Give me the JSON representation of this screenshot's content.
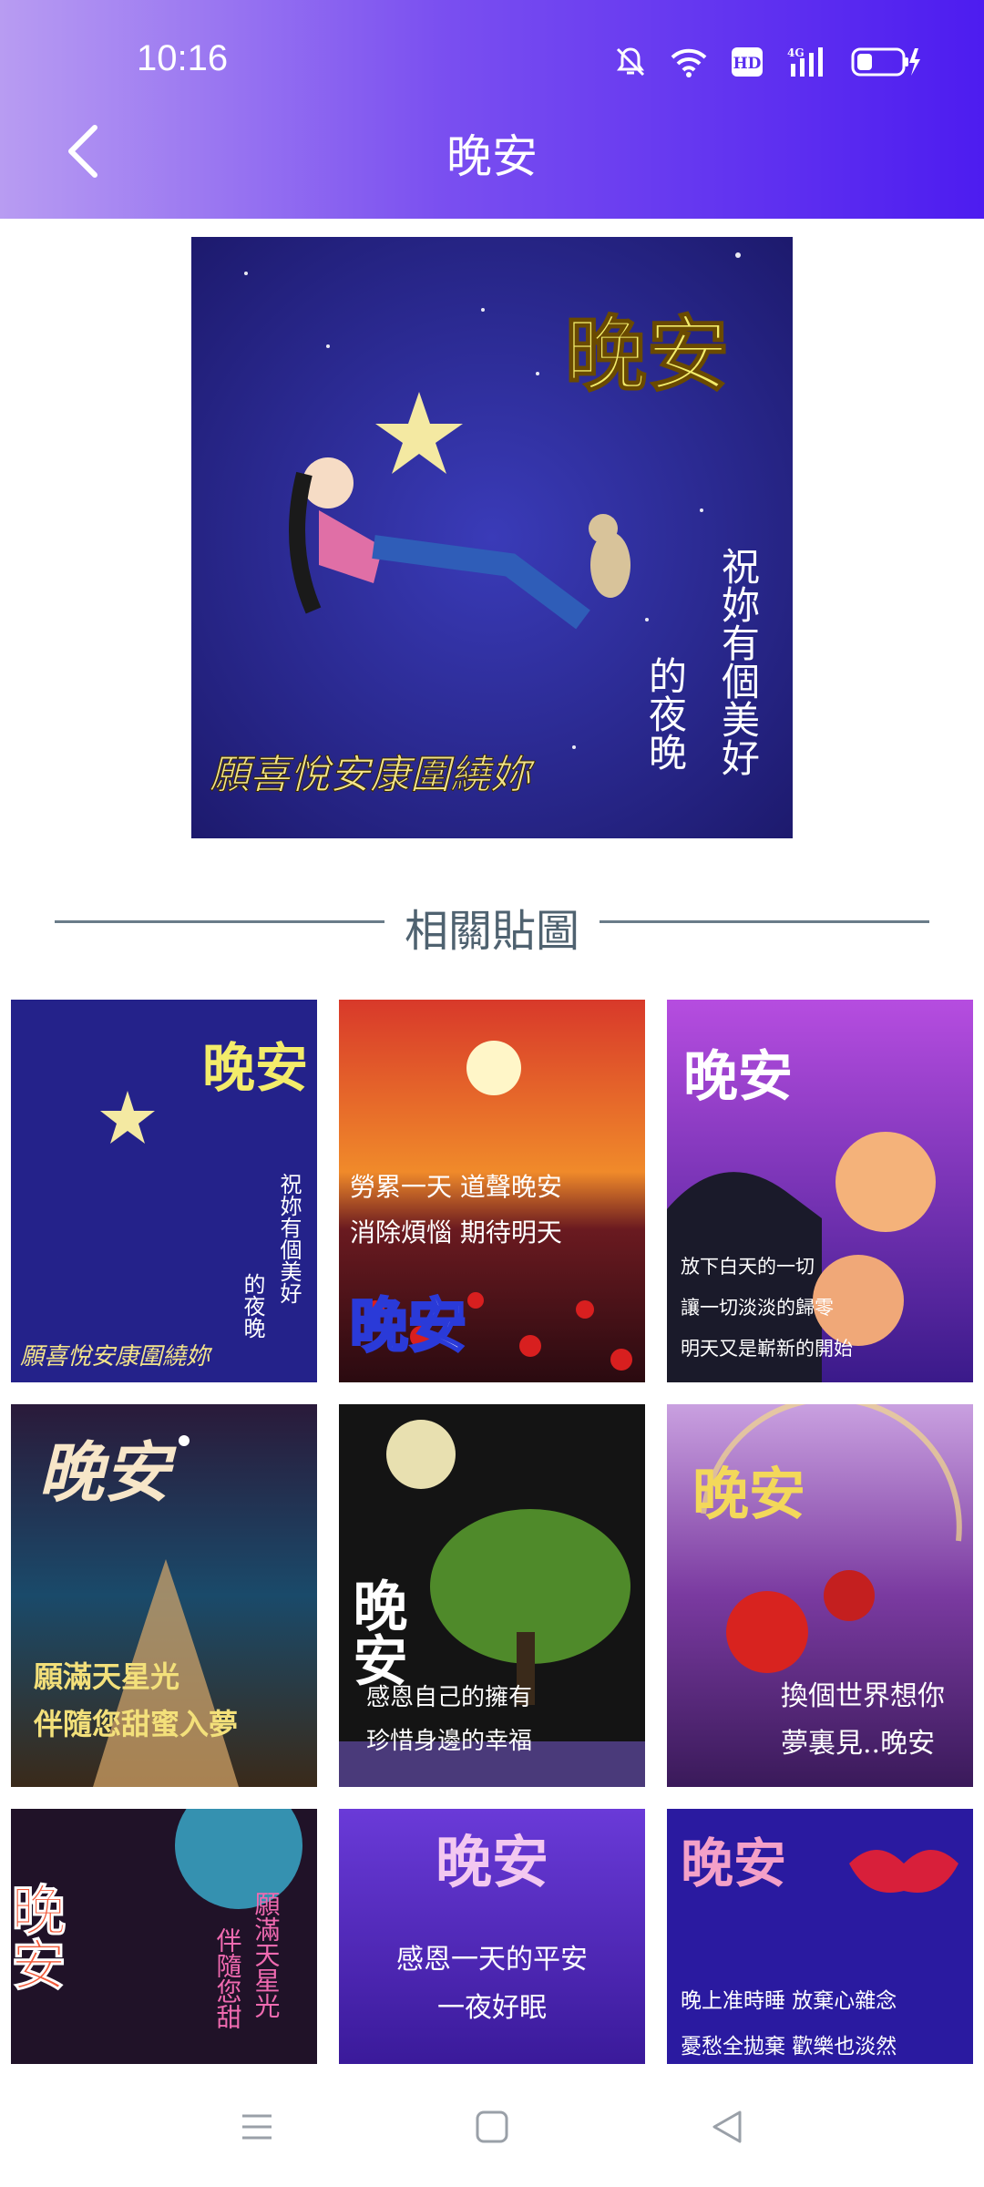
{
  "status_bar": {
    "time": "10:16"
  },
  "header": {
    "title": "晚安"
  },
  "hero": {
    "caption_title": "晚安",
    "caption_vertical_left": "的夜晚",
    "caption_vertical_right": "祝妳有個美好",
    "caption_bottom": "願喜悅安康圍繞妳"
  },
  "section": {
    "title": "相關貼圖"
  },
  "grid": [
    {
      "title": "晚安",
      "lines": [
        "祝妳有個美好",
        "的夜晚",
        "願喜悅安康圍繞妳"
      ]
    },
    {
      "title": "晚安",
      "lines": [
        "勞累一天  道聲晚安",
        "消除煩惱  期待明天"
      ]
    },
    {
      "title": "晚安",
      "lines": [
        "放下白天的一切",
        "讓一切淡淡的歸零",
        "明天又是嶄新的開始"
      ]
    },
    {
      "title": "晚安",
      "lines": [
        "願滿天星光",
        "伴隨您甜蜜入夢"
      ]
    },
    {
      "title": "晚安",
      "lines": [
        "感恩自己的擁有",
        "珍惜身邊的幸福"
      ]
    },
    {
      "title": "晚安",
      "lines": [
        "換個世界想你",
        "夢裏見..晚安"
      ]
    },
    {
      "title": "晚安",
      "lines": [
        "願滿天星光",
        "伴隨您甜"
      ]
    },
    {
      "title": "晚安",
      "lines": [
        "感恩一天的平安",
        "一夜好眠"
      ]
    },
    {
      "title": "晚安",
      "lines": [
        "晚上准時睡 放棄心雜念",
        "憂愁全拋棄 歡樂也淡然"
      ]
    }
  ],
  "colors": {
    "header_start": "#b89cf2",
    "header_end": "#4d1cf0",
    "divider": "#6a7c89"
  },
  "icons": {
    "back": "chevron-left-icon",
    "menu": "menu-icon",
    "home": "home-square-icon",
    "back_nav": "triangle-back-icon"
  }
}
